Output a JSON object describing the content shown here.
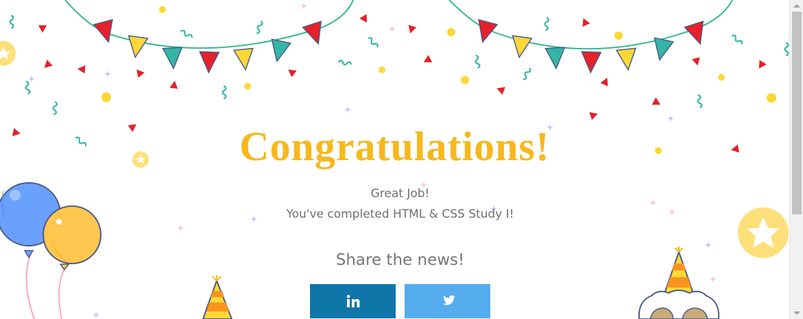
{
  "title": "Congratulations!",
  "message": {
    "line1": "Great Job!",
    "line2": "You've completed HTML & CSS Study I!"
  },
  "share": {
    "heading": "Share the news!",
    "buttons": [
      {
        "name": "linkedin",
        "icon": "linkedin-icon",
        "color": "#0e76a8"
      },
      {
        "name": "twitter",
        "icon": "twitter-icon",
        "color": "#55acee"
      }
    ]
  },
  "colors": {
    "title": "#f8b81c",
    "text": "#6f6f6f",
    "red": "#e8202a",
    "yellow": "#fdd835",
    "teal": "#35b5a5",
    "balloon_blue": "#6aa1ff",
    "balloon_yellow": "#ffc74f"
  }
}
